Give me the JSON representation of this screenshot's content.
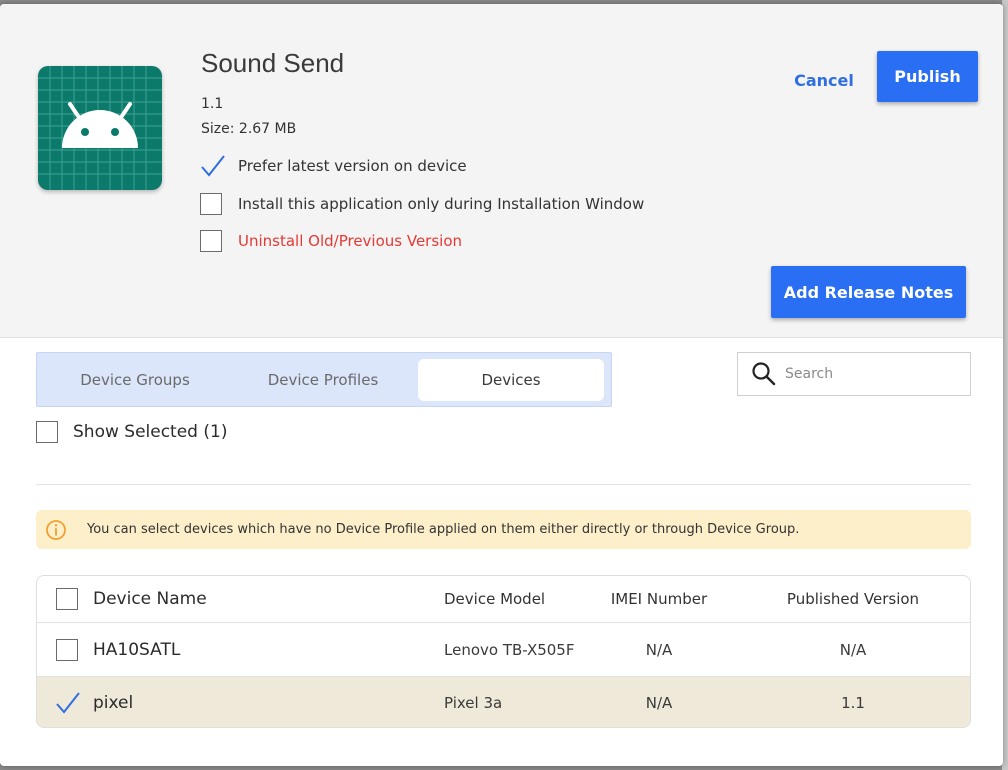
{
  "app": {
    "name": "Sound Send",
    "version": "1.1",
    "size": "Size: 2.67 MB",
    "icon": "android-icon",
    "icon_color": "#0b7a6b"
  },
  "options": [
    {
      "label": "Prefer latest version on device",
      "checked": true
    },
    {
      "label": "Install this application only during Installation Window",
      "checked": false
    },
    {
      "label": "Uninstall Old/Previous Version",
      "checked": false
    }
  ],
  "actions": {
    "cancel": "Cancel",
    "publish": "Publish",
    "release_notes": "Add Release Notes"
  },
  "tabs": [
    {
      "label": "Device Groups",
      "active": false
    },
    {
      "label": "Device Profiles",
      "active": false
    },
    {
      "label": "Devices",
      "active": true
    }
  ],
  "search": {
    "placeholder": "Search",
    "value": ""
  },
  "show_selected": {
    "label": "Show Selected (1)",
    "checked": false
  },
  "info": {
    "text": "You can select devices which have no Device Profile applied on them either directly or through Device Group."
  },
  "table": {
    "columns": [
      "Device Name",
      "Device Model",
      "IMEI Number",
      "Published Version"
    ],
    "rows": [
      {
        "name": "HA10SATL",
        "model": "Lenovo TB-X505F",
        "imei": "N/A",
        "version": "N/A",
        "selected": false
      },
      {
        "name": "pixel",
        "model": "Pixel 3a",
        "imei": "N/A",
        "version": "1.1",
        "selected": true
      }
    ]
  },
  "colors": {
    "primary": "#2a6ff3",
    "danger": "#e53935",
    "info_bg": "#fcefc9",
    "selected_row": "#efe9d9",
    "tabs_bg": "#dce6fa"
  }
}
